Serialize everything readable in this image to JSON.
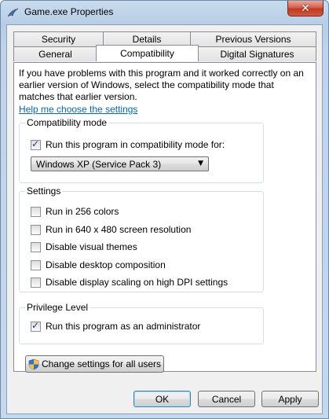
{
  "window": {
    "title": "Game.exe Properties"
  },
  "tabs": {
    "row1": [
      "Security",
      "Details",
      "Previous Versions"
    ],
    "row2": [
      "General",
      "Compatibility",
      "Digital Signatures"
    ],
    "active": "Compatibility"
  },
  "panel": {
    "intro": "If you have problems with this program and it worked correctly on an earlier version of Windows, select the compatibility mode that matches that earlier version.",
    "help_link": "Help me choose the settings",
    "compat_mode": {
      "title": "Compatibility mode",
      "checkbox_label": "Run this program in compatibility mode for:",
      "checked": true,
      "selected_os": "Windows XP (Service Pack 3)"
    },
    "settings": {
      "title": "Settings",
      "items": [
        {
          "label": "Run in 256 colors",
          "checked": false
        },
        {
          "label": "Run in 640 x 480 screen resolution",
          "checked": false
        },
        {
          "label": "Disable visual themes",
          "checked": false
        },
        {
          "label": "Disable desktop composition",
          "checked": false
        },
        {
          "label": "Disable display scaling on high DPI settings",
          "checked": false
        }
      ]
    },
    "privilege": {
      "title": "Privilege Level",
      "checkbox_label": "Run this program as an administrator",
      "checked": true
    },
    "change_all_users": "Change settings for all users"
  },
  "buttons": {
    "ok": "OK",
    "cancel": "Cancel",
    "apply": "Apply"
  }
}
